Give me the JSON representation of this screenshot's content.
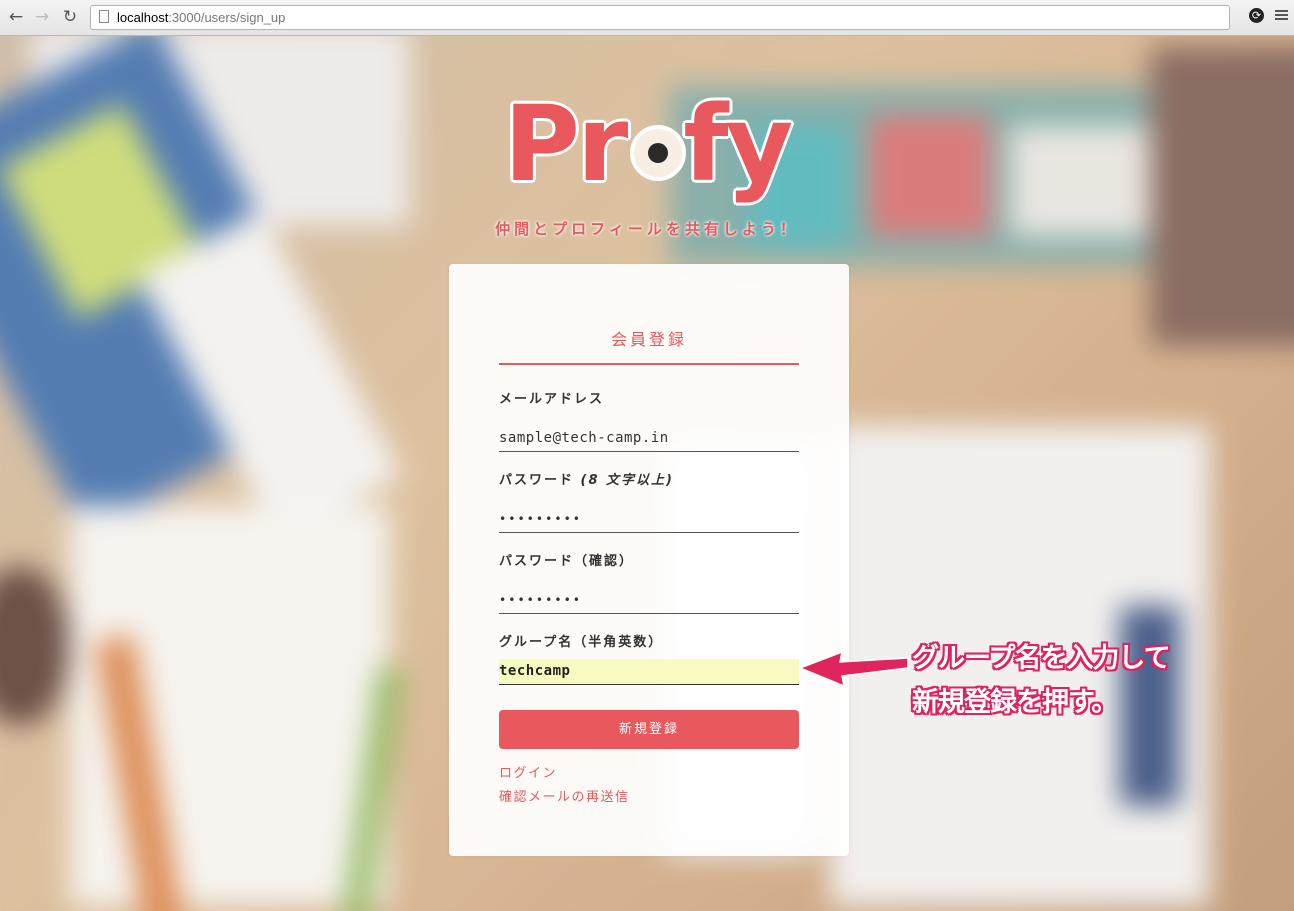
{
  "browser": {
    "url_host": "localhost",
    "url_path": ":3000/users/sign_up"
  },
  "logo": {
    "text_left": "Pr",
    "text_right": "fy",
    "tagline": "仲間とプロフィールを共有しよう！"
  },
  "form": {
    "title": "会員登録",
    "email": {
      "label": "メールアドレス",
      "value": "sample@tech-camp.in"
    },
    "password": {
      "label": "パスワード",
      "hint": "(8 文字以上)",
      "value": "•••••••••"
    },
    "password_confirm": {
      "label": "パスワード（確認）",
      "value": "•••••••••"
    },
    "group": {
      "label": "グループ名（半角英数）",
      "value": "techcamp"
    },
    "submit_label": "新規登録",
    "links": {
      "login": "ログイン",
      "resend": "確認メールの再送信"
    }
  },
  "annotation": {
    "line1": "グループ名を入力して",
    "line2": "新規登録を押す。",
    "color": "#e0245e"
  },
  "colors": {
    "brand": "#e8585c",
    "active_field": "#f7fbc0"
  }
}
